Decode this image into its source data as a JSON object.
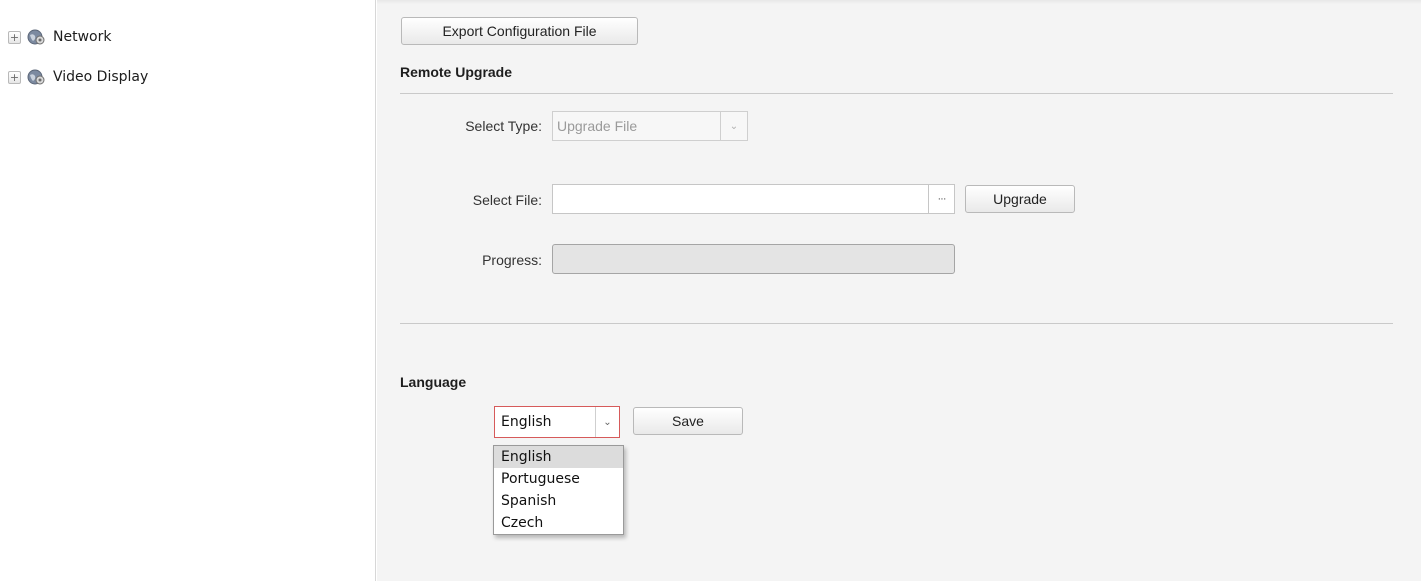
{
  "sidebar": {
    "items": [
      {
        "toggle": "+",
        "icon": "globe-gear-icon",
        "label": "Network"
      },
      {
        "toggle": "+",
        "icon": "globe-gear-icon",
        "label": "Video Display"
      }
    ]
  },
  "main": {
    "export_button_label": "Export Configuration File",
    "remote_upgrade": {
      "title": "Remote Upgrade",
      "select_type_label": "Select Type:",
      "select_type_value": "Upgrade File",
      "select_file_label": "Select File:",
      "select_file_value": "",
      "browse_label": "···",
      "upgrade_button_label": "Upgrade",
      "progress_label": "Progress:",
      "progress_value": 0
    },
    "language": {
      "title": "Language",
      "selected": "English",
      "save_button_label": "Save",
      "options": [
        "English",
        "Portuguese",
        "Spanish",
        "Czech"
      ]
    }
  },
  "colors": {
    "content_bg": "#f4f4f4",
    "focus_border": "#d65a5a",
    "option_highlight": "#dcdcdc"
  }
}
